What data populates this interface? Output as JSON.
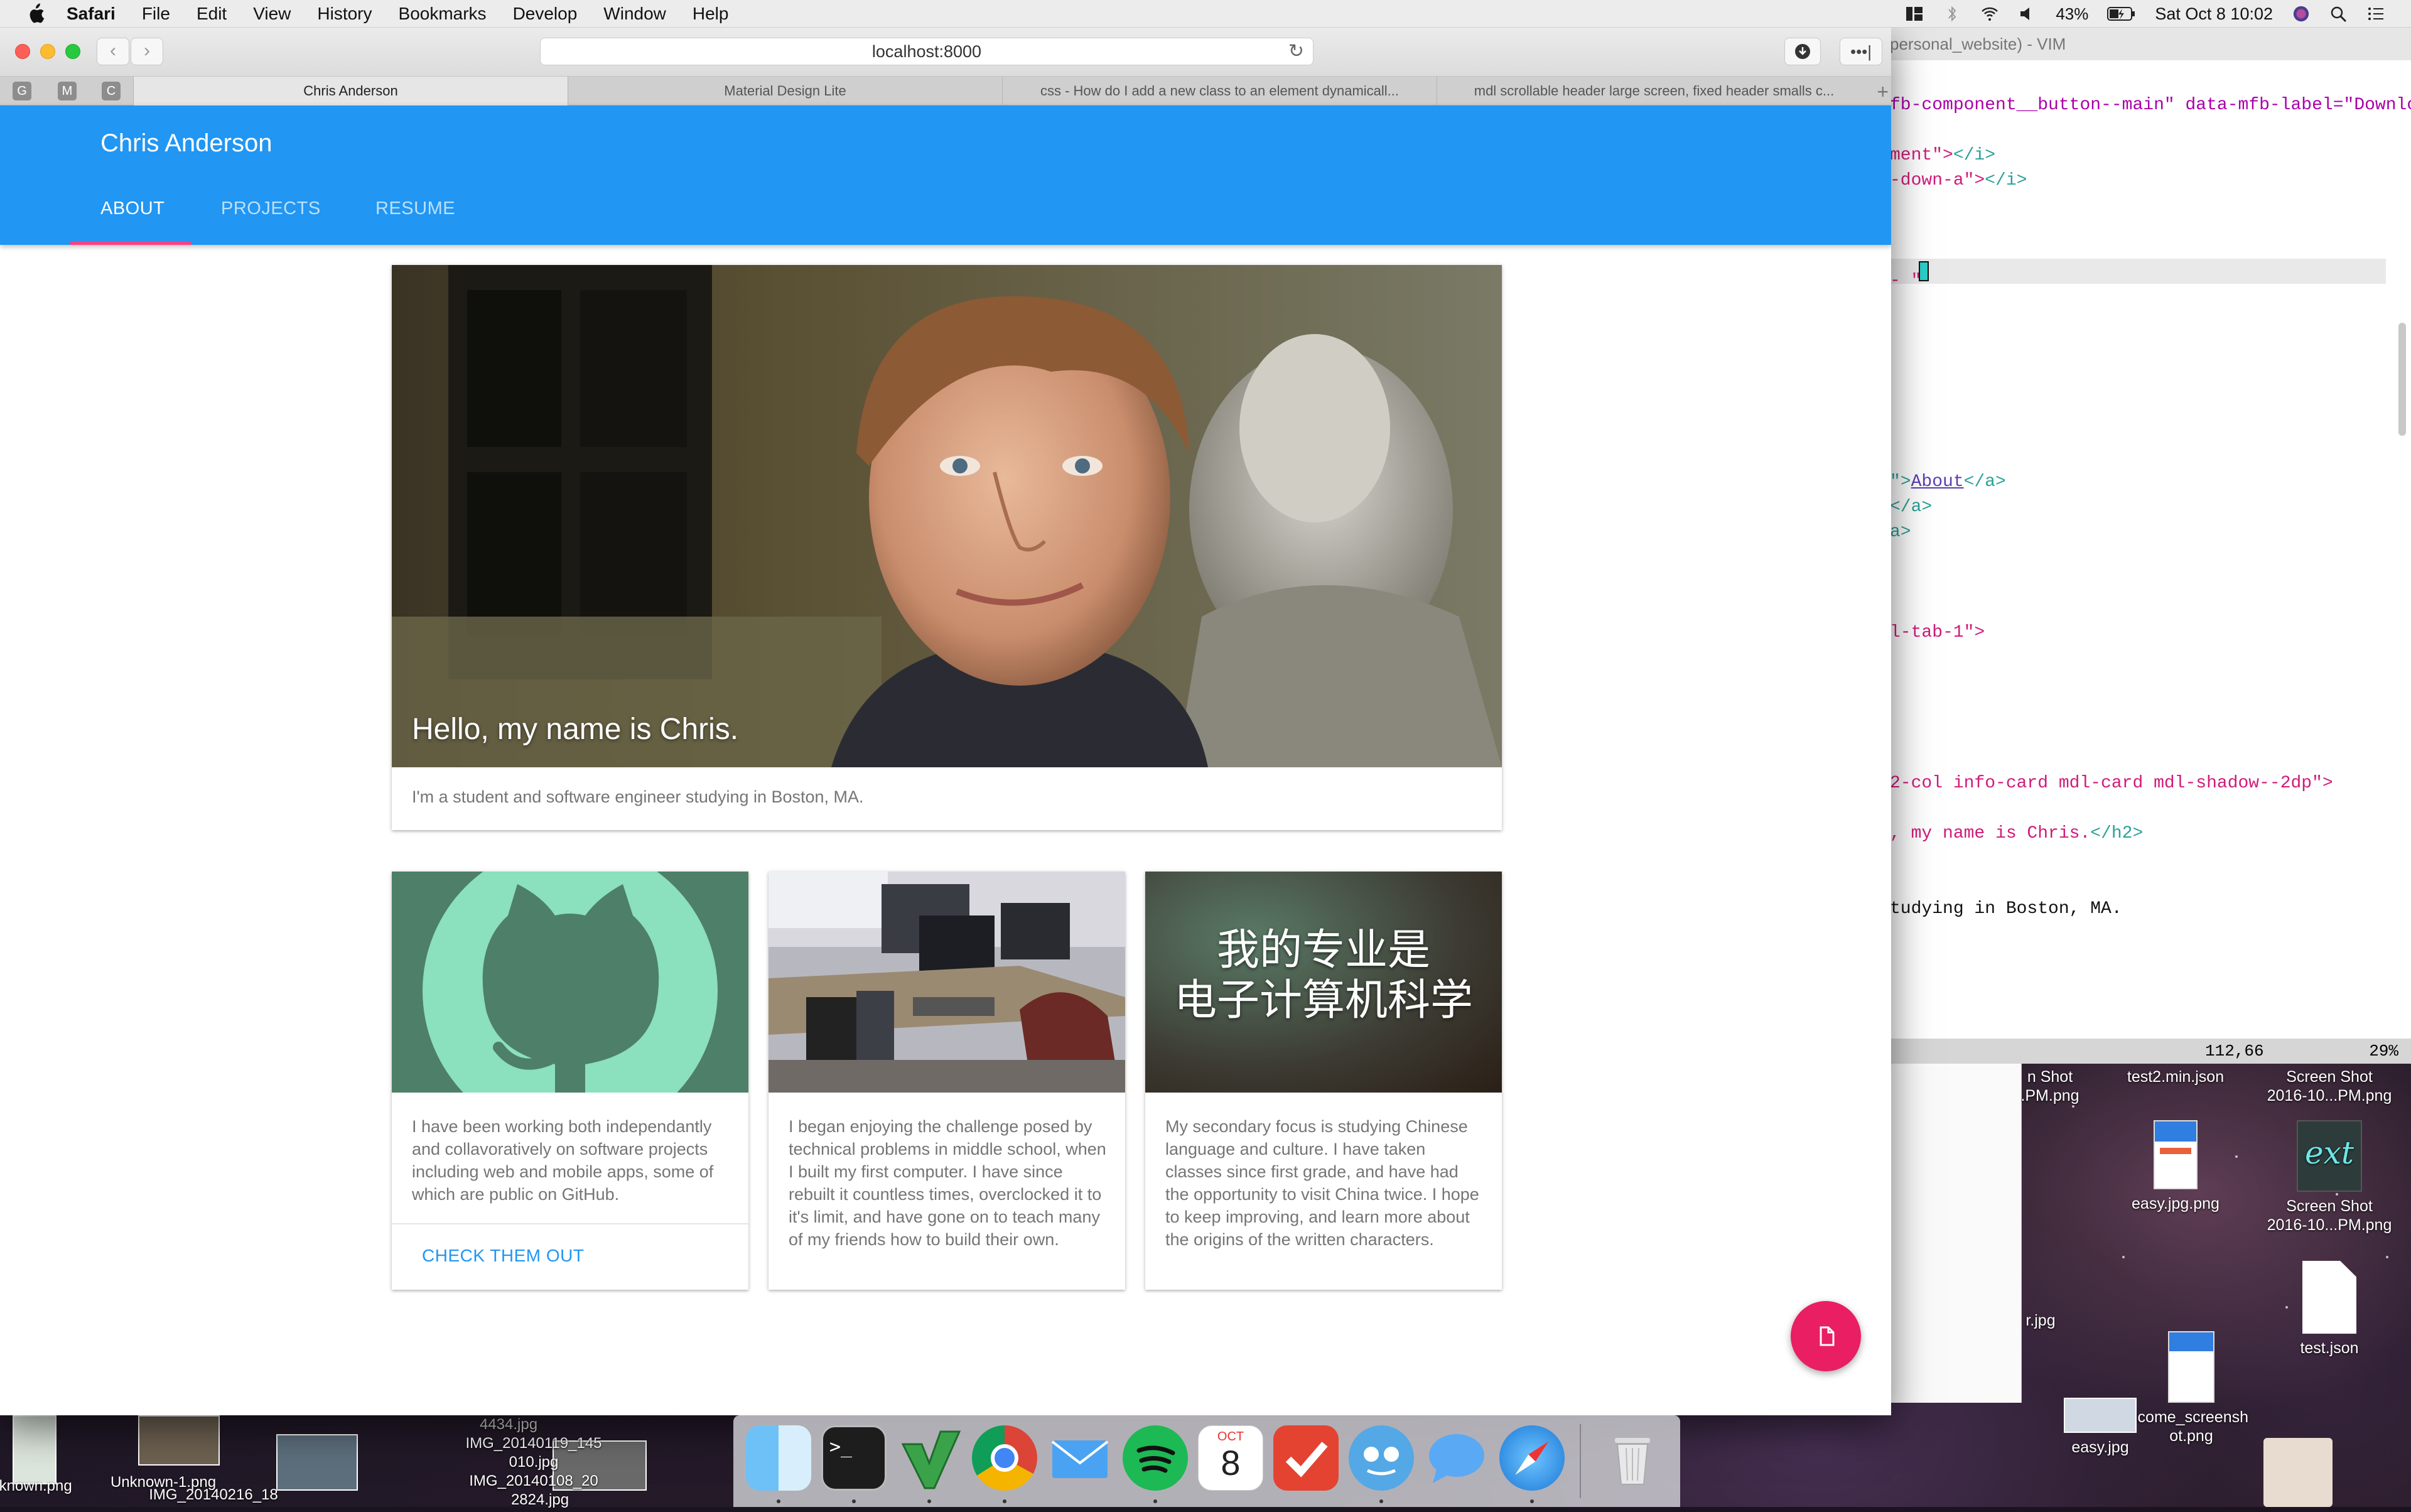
{
  "menubar": {
    "app": "Safari",
    "items": [
      "File",
      "Edit",
      "View",
      "History",
      "Bookmarks",
      "Develop",
      "Window",
      "Help"
    ],
    "battery": "43%",
    "datetime": "Sat Oct 8  10:02"
  },
  "browser": {
    "url": "localhost:8000",
    "pinned_tabs": [
      "G",
      "M",
      "C"
    ],
    "tabs": [
      "Chris Anderson",
      "Material Design Lite",
      "css - How do I add a new class to an element dynamicall...",
      "mdl scrollable header large screen, fixed header smalls c..."
    ]
  },
  "site": {
    "title": "Chris Anderson",
    "nav": [
      "ABOUT",
      "PROJECTS",
      "RESUME"
    ],
    "hero": {
      "caption": "Hello, my name is Chris.",
      "text": "I'm a student and software engineer studying in Boston, MA."
    },
    "cards": [
      {
        "text": "I have been working both independantly and collavoratively on software projects including web and mobile apps, some of which are public on GitHub.",
        "action": "CHECK THEM OUT"
      },
      {
        "text": "I began enjoying the challenge posed by technical problems in middle school, when I built my first computer. I have since rebuilt it countless times, overclocked it to it's limit, and have gone on to teach many of my friends how to build their own."
      },
      {
        "image_text_line1": "我的专业是",
        "image_text_line2": "电子计算机科学",
        "text": "My secondary focus is studying Chinese language and culture. I have taken classes since first grade, and have had the opportunity to visit China twice. I hope to keep improving, and learn more about the origins of the written characters."
      }
    ]
  },
  "vim": {
    "title": "personal_website) - VIM",
    "lines": [
      {
        "row": 1,
        "parts": [
          [
            "attr",
            "fb-component__button--main\" data-mfb-label=\"Downlo"
          ]
        ]
      },
      {
        "row": 3,
        "parts": [
          [
            "str",
            "ment\">"
          ],
          [
            "tag",
            "</i>"
          ]
        ]
      },
      {
        "row": 4,
        "parts": [
          [
            "str",
            "-down-a\">"
          ],
          [
            "tag",
            "</i>"
          ]
        ]
      },
      {
        "row": 8,
        "parts": [
          [
            "str",
            "- \""
          ]
        ]
      },
      {
        "row": 16,
        "parts": [
          [
            "tag",
            "\">"
          ],
          [
            "link",
            "About"
          ],
          [
            "tag",
            "</a>"
          ]
        ]
      },
      {
        "row": 17,
        "parts": [
          [
            "tag",
            "</a>"
          ]
        ]
      },
      {
        "row": 18,
        "parts": [
          [
            "tag",
            "a>"
          ]
        ]
      },
      {
        "row": 22,
        "parts": [
          [
            "str",
            "l-tab-1\">"
          ]
        ]
      },
      {
        "row": 28,
        "parts": [
          [
            "str",
            "2-col info-card mdl-card mdl-shadow--2dp\">"
          ]
        ]
      },
      {
        "row": 30,
        "parts": [
          [
            "str",
            ", my name is Chris."
          ],
          [
            "tag",
            "</h2>"
          ]
        ]
      },
      {
        "row": 33,
        "parts": [
          [
            "txt",
            "tudying in Boston, MA."
          ]
        ]
      }
    ],
    "status_pos": "112,66",
    "status_pct": "29%"
  },
  "desktop": {
    "icons": [
      {
        "label": "n Shot\n.PM.png"
      },
      {
        "label": "test2.min.json"
      },
      {
        "label": "Screen Shot\n2016-10...PM.png"
      },
      {
        "label": "easy.jpg.png"
      },
      {
        "label": "Screen Shot\n2016-10...PM.png"
      },
      {
        "label": "r.jpg"
      },
      {
        "label": "test.json"
      },
      {
        "label": "lcome_screensh\not.png"
      },
      {
        "label": "easy.jpg"
      },
      {
        "label": "nknown.png"
      },
      {
        "label": "Unknown-1.png"
      },
      {
        "label": "IMG_20140216_18"
      },
      {
        "label": "4434.jpg"
      },
      {
        "label": "IMG_20140119_145"
      },
      {
        "label": "010.jpg"
      },
      {
        "label": "IMG_20140108_20"
      },
      {
        "label": "2824.jpg"
      }
    ]
  },
  "dock": {
    "apps": [
      "finder-icon",
      "terminal-icon",
      "vim-icon",
      "chrome-icon",
      "mail-icon",
      "spotify-icon",
      "calendar-icon",
      "todoist-icon",
      "tweetbot-icon",
      "messages-icon",
      "safari-icon",
      "trash-icon"
    ],
    "calendar_month": "OCT",
    "calendar_day": "8"
  },
  "colors": {
    "mdl_primary": "#2196f3",
    "mdl_accent": "#ff4081",
    "fab": "#e91e63",
    "github_bg": "#4e7f68",
    "github_fg": "#8be0bd"
  }
}
